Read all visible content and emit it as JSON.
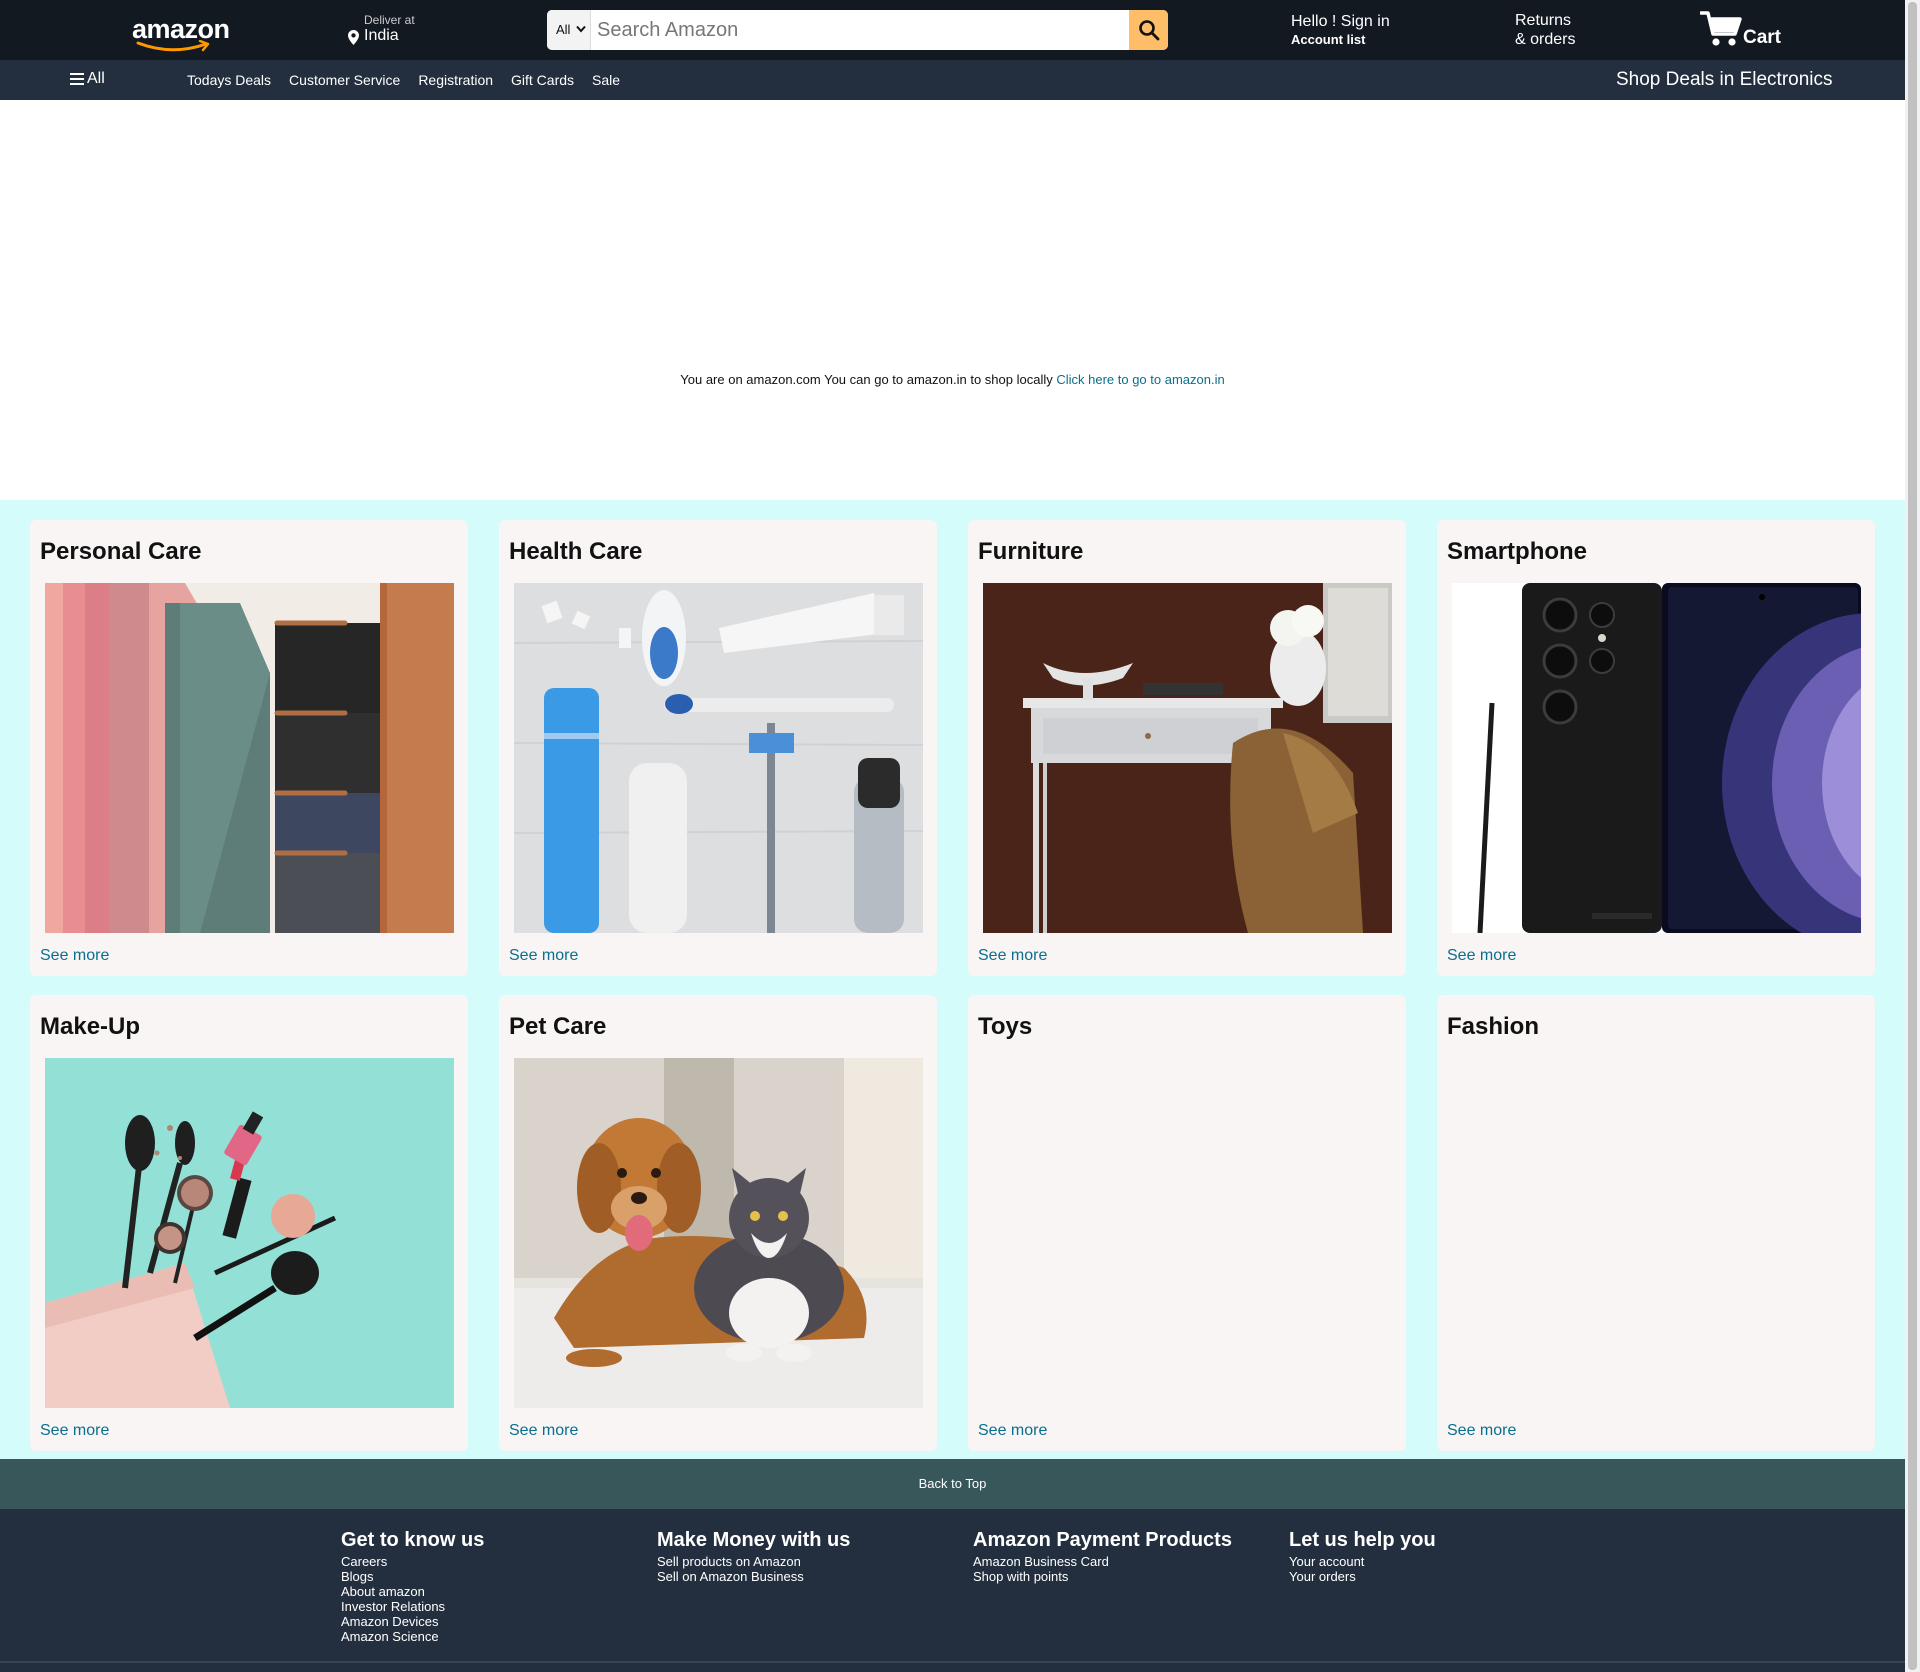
{
  "header": {
    "logo_text": "amazon",
    "deliver_label": "Deliver at",
    "deliver_value": "India",
    "search_category": "All",
    "search_placeholder": "Search Amazon",
    "signin_hello": "Hello ! Sign in",
    "signin_account": "Account list",
    "returns_line1": "Returns",
    "returns_line2": "& orders",
    "cart_label": "Cart"
  },
  "subnav": {
    "all_label": "All",
    "links": [
      "Todays Deals",
      "Customer Service",
      "Registration",
      "Gift Cards",
      "Sale"
    ],
    "promo": "Shop Deals in Electronics"
  },
  "notice": {
    "text": "You are on amazon.com You can go to amazon.in to shop locally",
    "link": "Click here to go to amazon.in"
  },
  "cards": [
    {
      "title": "Personal Care",
      "link": "See more"
    },
    {
      "title": "Health Care",
      "link": "See more"
    },
    {
      "title": "Furniture",
      "link": "See more"
    },
    {
      "title": "Smartphone",
      "link": "See more"
    },
    {
      "title": "Make-Up",
      "link": "See more"
    },
    {
      "title": "Pet Care",
      "link": "See more"
    },
    {
      "title": "Toys",
      "link": "See more"
    },
    {
      "title": "Fashion",
      "link": "See more"
    }
  ],
  "back_to_top": "Back to Top",
  "footer": {
    "columns": [
      {
        "heading": "Get to know us",
        "items": [
          "Careers",
          "Blogs",
          "About amazon",
          "Investor Relations",
          "Amazon Devices",
          "Amazon Science"
        ]
      },
      {
        "heading": "Make Money with us",
        "items": [
          "Sell products on Amazon",
          "Sell on Amazon Business"
        ]
      },
      {
        "heading": "Amazon Payment Products",
        "items": [
          "Amazon Business Card",
          "Shop with points"
        ]
      },
      {
        "heading": "Let us help you",
        "items": [
          "Your account",
          "Your orders"
        ]
      }
    ]
  },
  "colors": {
    "nav_bg": "#131921",
    "subnav_bg": "#232f3e",
    "search_button": "#febd69",
    "cards_bg": "#d4fcfb",
    "card_bg": "#f8f5f4",
    "link": "#0a6f8f",
    "back_to_top_bg": "#37575b"
  },
  "icons": [
    "pin-icon",
    "search-icon",
    "chevron-down-icon",
    "menu-icon",
    "cart-icon",
    "amazon-smile-icon"
  ]
}
